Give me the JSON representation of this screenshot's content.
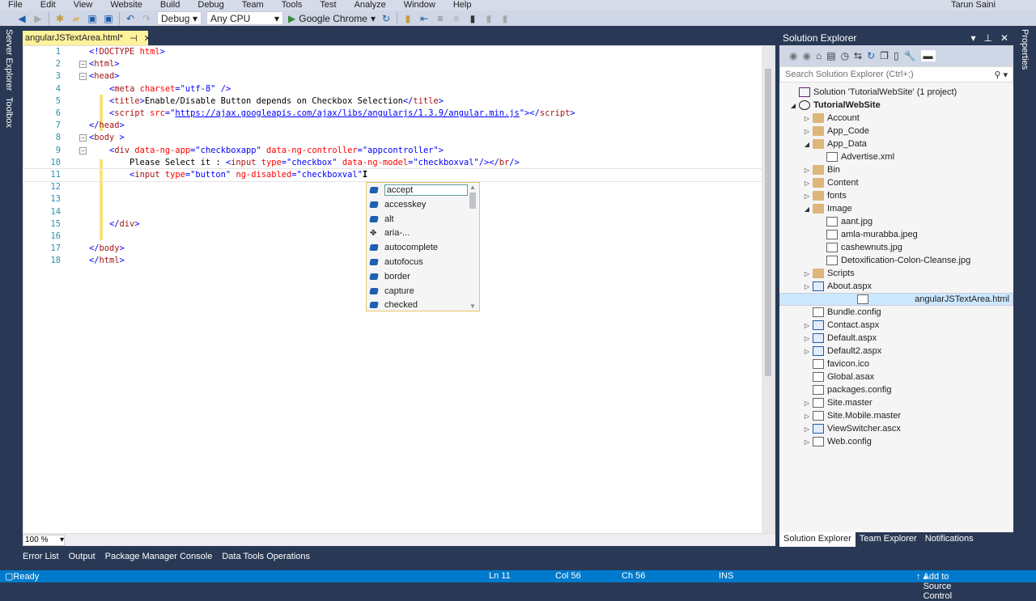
{
  "menu": {
    "items": [
      "File",
      "Edit",
      "View",
      "Website",
      "Build",
      "Debug",
      "Team",
      "Tools",
      "Test",
      "Analyze",
      "Window",
      "Help"
    ],
    "user": "Tarun Saini"
  },
  "toolbar": {
    "config": "Debug",
    "platform": "Any CPU",
    "run_target": "Google Chrome"
  },
  "left_strip": {
    "server_explorer": "Server Explorer",
    "toolbox": "Toolbox"
  },
  "editor": {
    "tab_title": "angularJSTextArea.html*",
    "zoom": "100 %",
    "lines": [
      {
        "n": "1",
        "fold": "",
        "t": [
          [
            "b",
            "<!"
          ],
          [
            "m",
            "DOCTYPE"
          ],
          [
            "b",
            " "
          ],
          [
            "r",
            "html"
          ],
          [
            "b",
            ">"
          ]
        ]
      },
      {
        "n": "2",
        "fold": "-",
        "t": [
          [
            "b",
            "<"
          ],
          [
            "m",
            "html"
          ],
          [
            "b",
            ">"
          ]
        ]
      },
      {
        "n": "3",
        "fold": "-",
        "t": [
          [
            "b",
            "<"
          ],
          [
            "m",
            "head"
          ],
          [
            "b",
            ">"
          ]
        ]
      },
      {
        "n": "4",
        "fold": "",
        "t": [
          [
            "k",
            "    "
          ],
          [
            "b",
            "<"
          ],
          [
            "m",
            "meta"
          ],
          [
            "k",
            " "
          ],
          [
            "r",
            "charset"
          ],
          [
            "b",
            "=\"utf-8\" />"
          ]
        ]
      },
      {
        "n": "5",
        "fold": "",
        "t": [
          [
            "k",
            "    "
          ],
          [
            "b",
            "<"
          ],
          [
            "m",
            "title"
          ],
          [
            "b",
            ">"
          ],
          [
            "k",
            "Enable/Disable Button depends on Checkbox Selection"
          ],
          [
            "b",
            "</"
          ],
          [
            "m",
            "title"
          ],
          [
            "b",
            ">"
          ]
        ]
      },
      {
        "n": "6",
        "fold": "",
        "t": [
          [
            "k",
            "    "
          ],
          [
            "b",
            "<"
          ],
          [
            "m",
            "script"
          ],
          [
            "k",
            " "
          ],
          [
            "r",
            "src"
          ],
          [
            "b",
            "=\""
          ],
          [
            "u",
            "https://ajax.googleapis.com/ajax/libs/angularjs/1.3.9/angular.min.js"
          ],
          [
            "b",
            "\"></"
          ],
          [
            "m",
            "script"
          ],
          [
            "b",
            ">"
          ]
        ]
      },
      {
        "n": "7",
        "fold": "",
        "t": [
          [
            "b",
            "</"
          ],
          [
            "m",
            "head"
          ],
          [
            "b",
            ">"
          ]
        ]
      },
      {
        "n": "8",
        "fold": "-",
        "t": [
          [
            "b",
            "<"
          ],
          [
            "m",
            "body"
          ],
          [
            "b",
            " >"
          ]
        ]
      },
      {
        "n": "9",
        "fold": "-",
        "t": [
          [
            "k",
            "    "
          ],
          [
            "b",
            "<"
          ],
          [
            "m",
            "div"
          ],
          [
            "k",
            " "
          ],
          [
            "r",
            "data-ng-app"
          ],
          [
            "b",
            "=\"checkboxapp\""
          ],
          [
            "k",
            " "
          ],
          [
            "r",
            "data-ng-controller"
          ],
          [
            "b",
            "=\"appcontroller\">"
          ]
        ]
      },
      {
        "n": "10",
        "fold": "",
        "t": [
          [
            "k",
            "        Please Select it : "
          ],
          [
            "b",
            "<"
          ],
          [
            "m",
            "input"
          ],
          [
            "k",
            " "
          ],
          [
            "r",
            "type"
          ],
          [
            "b",
            "=\"checkbox\""
          ],
          [
            "k",
            " "
          ],
          [
            "r",
            "data-ng-model"
          ],
          [
            "b",
            "=\"checkboxval\"/></"
          ],
          [
            "m",
            "br"
          ],
          [
            "b",
            "/>"
          ]
        ]
      },
      {
        "n": "11",
        "fold": "",
        "t": [
          [
            "k",
            "        "
          ],
          [
            "b",
            "<"
          ],
          [
            "m",
            "input"
          ],
          [
            "k",
            " "
          ],
          [
            "r",
            "type"
          ],
          [
            "b",
            "=\"button\""
          ],
          [
            "k",
            " "
          ],
          [
            "r",
            "ng-disabled"
          ],
          [
            "b",
            "=\"checkboxval\""
          ]
        ]
      },
      {
        "n": "12",
        "fold": "",
        "t": []
      },
      {
        "n": "13",
        "fold": "",
        "t": []
      },
      {
        "n": "14",
        "fold": "",
        "t": []
      },
      {
        "n": "15",
        "fold": "",
        "t": [
          [
            "k",
            "    "
          ],
          [
            "b",
            "</"
          ],
          [
            "m",
            "div"
          ],
          [
            "b",
            ">"
          ]
        ]
      },
      {
        "n": "16",
        "fold": "",
        "t": []
      },
      {
        "n": "17",
        "fold": "",
        "t": [
          [
            "b",
            "</"
          ],
          [
            "m",
            "body"
          ],
          [
            "b",
            ">"
          ]
        ]
      },
      {
        "n": "18",
        "fold": "",
        "t": [
          [
            "b",
            "</"
          ],
          [
            "m",
            "html"
          ],
          [
            "b",
            ">"
          ]
        ]
      }
    ]
  },
  "intellisense": {
    "items": [
      "accept",
      "accesskey",
      "alt",
      "aria-...",
      "autocomplete",
      "autofocus",
      "border",
      "capture",
      "checked"
    ],
    "selected": "accept"
  },
  "solution_explorer": {
    "title": "Solution Explorer",
    "search_placeholder": "Search Solution Explorer (Ctrl+;)",
    "items": [
      {
        "label": "Solution 'TutorialWebSite' (1 project)",
        "level": 0,
        "exp": "",
        "icon": "sln"
      },
      {
        "label": "TutorialWebSite",
        "level": 0,
        "exp": "expanded",
        "icon": "globe",
        "bold": true
      },
      {
        "label": "Account",
        "level": 1,
        "exp": "collapsed",
        "icon": "folder"
      },
      {
        "label": "App_Code",
        "level": 1,
        "exp": "collapsed",
        "icon": "folder"
      },
      {
        "label": "App_Data",
        "level": 1,
        "exp": "expanded",
        "icon": "folder"
      },
      {
        "label": "Advertise.xml",
        "level": 2,
        "exp": "",
        "icon": "file"
      },
      {
        "label": "Bin",
        "level": 1,
        "exp": "collapsed",
        "icon": "folder"
      },
      {
        "label": "Content",
        "level": 1,
        "exp": "collapsed",
        "icon": "folder"
      },
      {
        "label": "fonts",
        "level": 1,
        "exp": "collapsed",
        "icon": "folder"
      },
      {
        "label": "Image",
        "level": 1,
        "exp": "expanded",
        "icon": "folder"
      },
      {
        "label": "aant.jpg",
        "level": 2,
        "exp": "",
        "icon": "file"
      },
      {
        "label": "amla-murabba.jpeg",
        "level": 2,
        "exp": "",
        "icon": "file"
      },
      {
        "label": "cashewnuts.jpg",
        "level": 2,
        "exp": "",
        "icon": "file"
      },
      {
        "label": "Detoxification-Colon-Cleanse.jpg",
        "level": 2,
        "exp": "",
        "icon": "file"
      },
      {
        "label": "Scripts",
        "level": 1,
        "exp": "collapsed",
        "icon": "folder"
      },
      {
        "label": "About.aspx",
        "level": 1,
        "exp": "collapsed",
        "icon": "aspx"
      },
      {
        "label": "angularJSTextArea.html",
        "level": 1,
        "exp": "",
        "icon": "file",
        "selected": true
      },
      {
        "label": "Bundle.config",
        "level": 1,
        "exp": "",
        "icon": "file"
      },
      {
        "label": "Contact.aspx",
        "level": 1,
        "exp": "collapsed",
        "icon": "aspx"
      },
      {
        "label": "Default.aspx",
        "level": 1,
        "exp": "collapsed",
        "icon": "aspx"
      },
      {
        "label": "Default2.aspx",
        "level": 1,
        "exp": "collapsed",
        "icon": "aspx"
      },
      {
        "label": "favicon.ico",
        "level": 1,
        "exp": "",
        "icon": "file"
      },
      {
        "label": "Global.asax",
        "level": 1,
        "exp": "",
        "icon": "file"
      },
      {
        "label": "packages.config",
        "level": 1,
        "exp": "",
        "icon": "file"
      },
      {
        "label": "Site.master",
        "level": 1,
        "exp": "collapsed",
        "icon": "file"
      },
      {
        "label": "Site.Mobile.master",
        "level": 1,
        "exp": "collapsed",
        "icon": "file"
      },
      {
        "label": "ViewSwitcher.ascx",
        "level": 1,
        "exp": "collapsed",
        "icon": "aspx"
      },
      {
        "label": "Web.config",
        "level": 1,
        "exp": "collapsed",
        "icon": "file"
      }
    ],
    "tabs": [
      "Solution Explorer",
      "Team Explorer",
      "Notifications"
    ]
  },
  "properties_strip": "Properties",
  "bottom_tabs": [
    "Error List",
    "Output",
    "Package Manager Console",
    "Data Tools Operations"
  ],
  "status": {
    "ready": "Ready",
    "ln": "Ln 11",
    "col": "Col 56",
    "ch": "Ch 56",
    "mode": "INS",
    "source_control": "Add to Source Control"
  },
  "colors": {
    "status_bar": "#007acc",
    "frame": "#293955",
    "active_tab": "#fff29d"
  }
}
